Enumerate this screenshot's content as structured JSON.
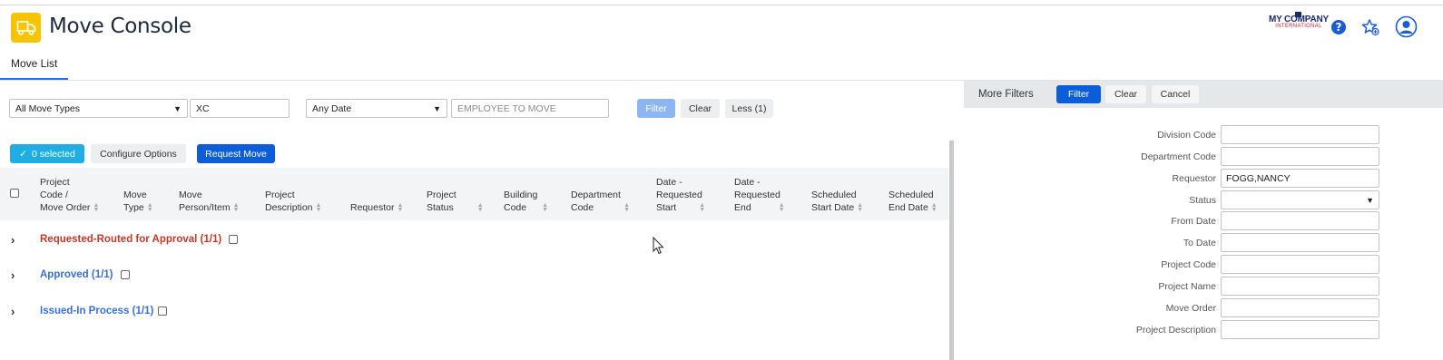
{
  "app": {
    "title": "Move Console",
    "logo_main": "MY COMPANY",
    "logo_sub": "INTERNATIONAL",
    "accent_color": "#f7c500"
  },
  "header_icons": [
    "help-icon",
    "favorite-star-icon",
    "user-avatar-icon"
  ],
  "tabs": [
    {
      "label": "Move List"
    }
  ],
  "filters": {
    "move_type": "All Move Types",
    "move_type_text": "XC",
    "date": "Any Date",
    "employee_placeholder": "EMPLOYEE TO MOVE",
    "filter_label": "Filter",
    "clear_label": "Clear",
    "less_label": "Less (1)"
  },
  "toolbar": {
    "selected_label": "0 selected",
    "configure_label": "Configure Options",
    "request_label": "Request Move"
  },
  "columns": [
    {
      "line1": "Project",
      "line2": "Code /",
      "line3": "Move Order"
    },
    {
      "line1": "",
      "line2": "Move",
      "line3": "Type"
    },
    {
      "line1": "",
      "line2": "Move",
      "line3": "Person/Item"
    },
    {
      "line1": "",
      "line2": "Project",
      "line3": "Description"
    },
    {
      "line1": "",
      "line2": "",
      "line3": "Requestor"
    },
    {
      "line1": "",
      "line2": "Project",
      "line3": "Status"
    },
    {
      "line1": "",
      "line2": "Building",
      "line3": "Code"
    },
    {
      "line1": "",
      "line2": "Department",
      "line3": "Code"
    },
    {
      "line1": "Date -",
      "line2": "Requested",
      "line3": "Start"
    },
    {
      "line1": "Date -",
      "line2": "Requested",
      "line3": "End"
    },
    {
      "line1": "",
      "line2": "Scheduled",
      "line3": "Start Date"
    },
    {
      "line1": "",
      "line2": "Scheduled",
      "line3": "End Date"
    }
  ],
  "groups": [
    {
      "label": "Requested-Routed for Approval (1/1)",
      "color": "#c0392b"
    },
    {
      "label": "Approved (1/1)",
      "color": "#3a6fd8"
    },
    {
      "label": "Issued-In Process (1/1)",
      "color": "#3a6fd8"
    }
  ],
  "more_filters": {
    "title": "More Filters",
    "filter_label": "Filter",
    "clear_label": "Clear",
    "cancel_label": "Cancel",
    "fields": [
      {
        "label": "Division Code",
        "value": ""
      },
      {
        "label": "Department Code",
        "value": ""
      },
      {
        "label": "Requestor",
        "value": "FOGG,NANCY"
      },
      {
        "label": "Status",
        "value": ""
      },
      {
        "label": "From Date",
        "value": ""
      },
      {
        "label": "To Date",
        "value": ""
      },
      {
        "label": "Project Code",
        "value": ""
      },
      {
        "label": "Project Name",
        "value": ""
      },
      {
        "label": "Move Order",
        "value": ""
      },
      {
        "label": "Project Description",
        "value": ""
      }
    ]
  }
}
